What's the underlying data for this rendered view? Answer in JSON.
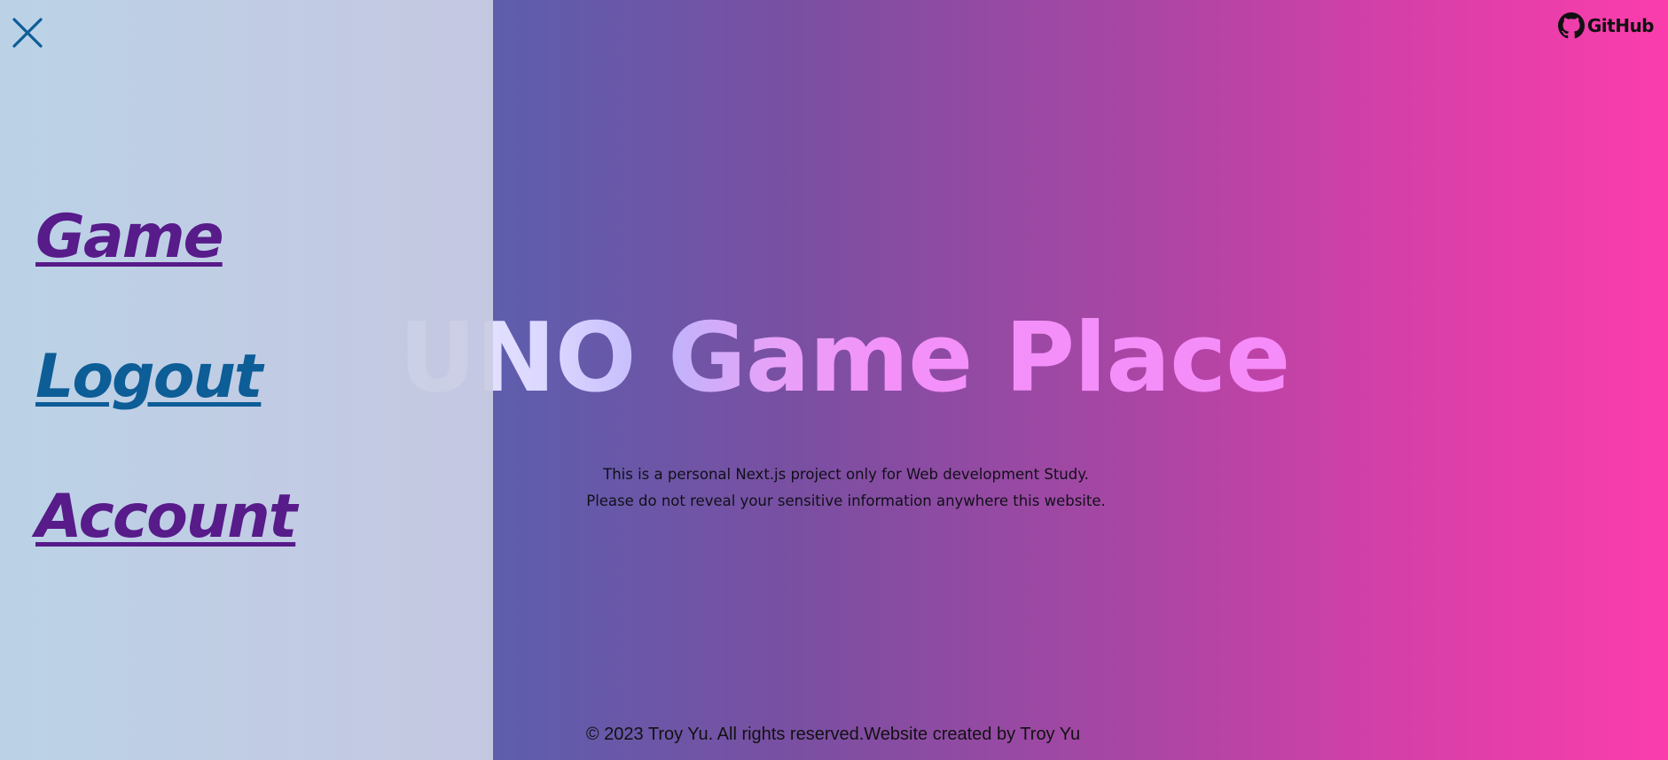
{
  "hero": {
    "title": "UNO Game Place"
  },
  "notice": {
    "line1": "This is a personal Next.js project only for Web development Study.",
    "line2": "Please do not reveal your sensitive information anywhere this website."
  },
  "footer": {
    "text": "© 2023 Troy Yu. All rights reserved.Website created by Troy Yu"
  },
  "header": {
    "github_label": "GitHub",
    "github_icon": "github-icon"
  },
  "sidebar": {
    "close_icon": "close-icon",
    "items": [
      {
        "label": "Game"
      },
      {
        "label": "Logout"
      },
      {
        "label": "Account"
      }
    ]
  },
  "colors": {
    "nav_link": "#571b8a",
    "nav_link_hover": "#0d5d97",
    "close_icon": "#0d5d97",
    "gradient_start": "#4f63b0",
    "gradient_end": "#fb3dac"
  }
}
